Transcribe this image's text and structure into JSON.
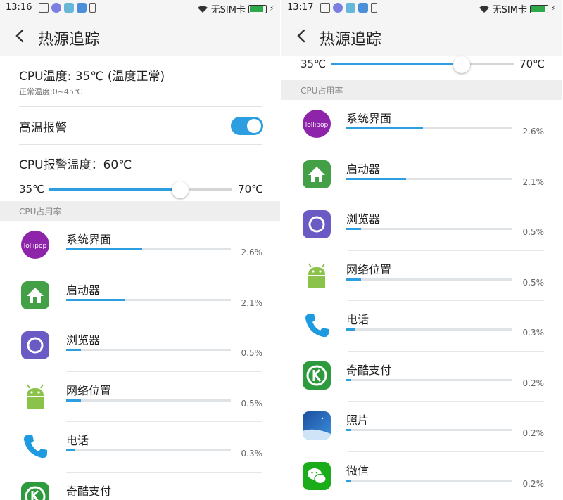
{
  "colors": {
    "accent": "#2d9ee0",
    "track": "#d5d5d5",
    "section_bg": "#eeeeee"
  },
  "left": {
    "status": {
      "time": "13:16",
      "carrier": "无SIM卡"
    },
    "title": "热源追踪",
    "cpu_temp": {
      "text": "CPU温度: 35℃ (温度正常)",
      "normal_range": "正常温度:0~45℃"
    },
    "alarm": {
      "label": "高温报警",
      "enabled": true
    },
    "alarm_temp": {
      "label": "CPU报警温度：60℃",
      "min_label": "35℃",
      "max_label": "70℃",
      "min": 35,
      "max": 70,
      "value": 60
    },
    "section_header": "CPU占用率",
    "items": [
      {
        "name": "系统界面",
        "percent": "2.6%",
        "usage": 0.46,
        "icon": "lollipop-icon"
      },
      {
        "name": "启动器",
        "percent": "2.1%",
        "usage": 0.36,
        "icon": "launcher-home-icon"
      },
      {
        "name": "浏览器",
        "percent": "0.5%",
        "usage": 0.09,
        "icon": "browser-icon"
      },
      {
        "name": "网络位置",
        "percent": "0.5%",
        "usage": 0.09,
        "icon": "android-icon"
      },
      {
        "name": "电话",
        "percent": "0.3%",
        "usage": 0.05,
        "icon": "phone-icon"
      },
      {
        "name": "奇酷支付",
        "percent": "",
        "usage": 0,
        "icon": "qiku-pay-icon"
      }
    ]
  },
  "right": {
    "status": {
      "time": "13:17",
      "carrier": "无SIM卡"
    },
    "title": "热源追踪",
    "alarm_temp": {
      "min_label": "35℃",
      "max_label": "70℃",
      "min": 35,
      "max": 70,
      "value": 60
    },
    "section_header": "CPU占用率",
    "items": [
      {
        "name": "系统界面",
        "percent": "2.6%",
        "usage": 0.46,
        "icon": "lollipop-icon"
      },
      {
        "name": "启动器",
        "percent": "2.1%",
        "usage": 0.36,
        "icon": "launcher-home-icon"
      },
      {
        "name": "浏览器",
        "percent": "0.5%",
        "usage": 0.09,
        "icon": "browser-icon"
      },
      {
        "name": "网络位置",
        "percent": "0.5%",
        "usage": 0.09,
        "icon": "android-icon"
      },
      {
        "name": "电话",
        "percent": "0.3%",
        "usage": 0.05,
        "icon": "phone-icon"
      },
      {
        "name": "奇酷支付",
        "percent": "0.2%",
        "usage": 0.03,
        "icon": "qiku-pay-icon"
      },
      {
        "name": "照片",
        "percent": "0.2%",
        "usage": 0.03,
        "icon": "photos-icon"
      },
      {
        "name": "微信",
        "percent": "0.2%",
        "usage": 0.03,
        "icon": "wechat-icon"
      }
    ]
  }
}
